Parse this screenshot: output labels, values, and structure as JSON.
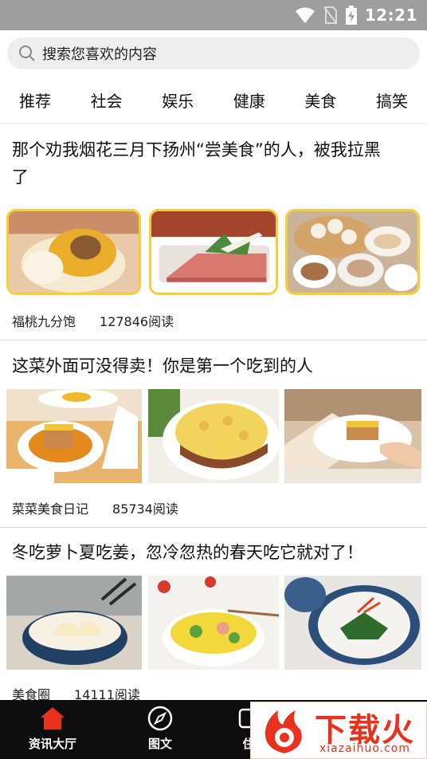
{
  "status_bar": {
    "time": "12:21",
    "icons": [
      "wifi-icon",
      "no-sim-icon",
      "battery-charging-icon"
    ]
  },
  "search": {
    "placeholder": "搜索您喜欢的内容"
  },
  "tabs": [
    {
      "label": "推荐"
    },
    {
      "label": "社会"
    },
    {
      "label": "娱乐"
    },
    {
      "label": "健康"
    },
    {
      "label": "美食"
    },
    {
      "label": "搞笑"
    }
  ],
  "articles": [
    {
      "title_line1": "那个劝我烟花三月下扬州“尝美食”的人，被我拉黑",
      "title_line2": "了",
      "source": "福桃九分饱",
      "reads": "127846阅读",
      "images": [
        "xiaolongbao-bun",
        "sliced-ham-plate",
        "dim-sum-baskets"
      ]
    },
    {
      "title": "这菜外面可没得卖！你是第一个吃到的人",
      "source": "菜菜美食日记",
      "reads": "85734阅读",
      "images": [
        "layered-rice-cake",
        "baked-casserole",
        "plated-rice-cake"
      ]
    },
    {
      "title": "冬吃萝卜夏吃姜，忽冷忽热的春天吃它就对了！",
      "source": "美食圈",
      "reads": "14111阅读",
      "images": [
        "dumpling-bowl",
        "vegetable-rice-bowl",
        "greens-plate"
      ]
    }
  ],
  "bottom_nav": [
    {
      "label": "资讯大厅",
      "icon": "home-icon",
      "active": true
    },
    {
      "label": "图文",
      "icon": "compass-icon",
      "active": false
    },
    {
      "label": "住",
      "icon": "other-icon",
      "active": false
    }
  ],
  "watermark": {
    "main": "下载火",
    "sub": "xiazaihuo.com"
  },
  "colors": {
    "status_bar": "#9e9e9e",
    "frame_yellow": "#f5cf38",
    "nav_background": "#0d0d0d",
    "nav_active_icon": "#e8321e",
    "watermark_red": "#e8321e"
  }
}
